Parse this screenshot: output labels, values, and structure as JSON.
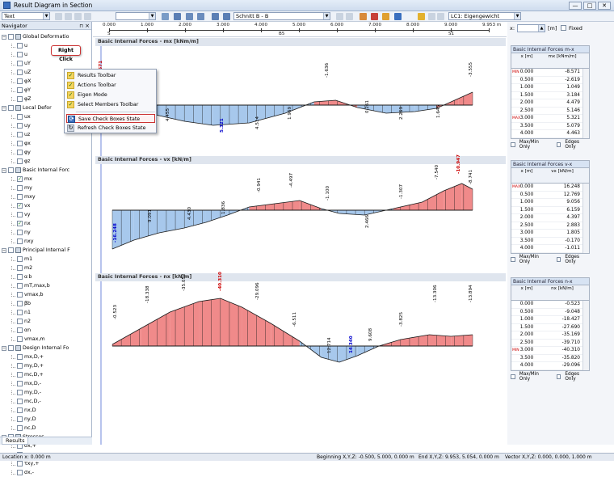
{
  "window": {
    "title": "Result Diagram in Section",
    "min": "—",
    "max": "□",
    "close": "✕"
  },
  "toolbar": {
    "text_combo": "Text",
    "section_combo": "Schnitt B - B",
    "lc_combo": "LC1: Eigengewicht"
  },
  "navigator": {
    "title": "Navigator",
    "tab": "Results",
    "groups": [
      {
        "label": "Global Deformatio",
        "items": [
          "u",
          "u",
          "uY",
          "uZ",
          "φX",
          "φY",
          "φZ"
        ]
      },
      {
        "label": "Local Defor",
        "items": [
          "ux",
          "uy",
          "uz",
          "φx",
          "φy",
          "φz"
        ]
      },
      {
        "label": "Basic Internal Forc",
        "items": [
          "mx",
          "my",
          "mxy",
          "vx",
          "vy",
          "nx",
          "ny",
          "nxy"
        ],
        "checked": [
          0,
          3,
          5
        ]
      },
      {
        "label": "Principal Internal F",
        "items": [
          "m1",
          "m2",
          "α b",
          "mT,max,b",
          "vmax,b",
          "βb",
          "n1",
          "n2",
          "αn",
          "vmax,m"
        ]
      },
      {
        "label": "Design Internal Fo",
        "items": [
          "mx,D,+",
          "my,D,+",
          "mc,D,+",
          "mx,D,-",
          "my,D,-",
          "mc,D,-",
          "nx,D",
          "ny,D",
          "nc,D"
        ]
      },
      {
        "label": "Stresses",
        "items": [
          "σx,+",
          "σy,+",
          "τxy,+",
          "σx,-"
        ]
      }
    ]
  },
  "callout": "Right Click",
  "context_menu": {
    "items": [
      {
        "label": "Results Toolbar",
        "checked": true
      },
      {
        "label": "Actions Toolbar",
        "checked": true
      },
      {
        "label": "Eigen Mode",
        "checked": true
      },
      {
        "label": "Select Members Toolbar",
        "checked": true
      }
    ],
    "save": "Save Check Boxes State",
    "refresh": "Refresh Check Boxes State"
  },
  "ruler": {
    "ticks": [
      "0.000",
      "1.000",
      "2.000",
      "3.000",
      "4.000",
      "5.000",
      "6.000",
      "7.000",
      "8.000",
      "9.000",
      "9.953 m"
    ],
    "labels": [
      "S",
      "B5",
      "S1"
    ],
    "scale_label": "0.1"
  },
  "right_controls": {
    "x_label": "x:",
    "unit": "[m]",
    "fixed": "Fixed"
  },
  "panels": [
    {
      "title": "Basic Internal Forces - mx [kNm/m]",
      "labels": [
        "-8.571",
        "4.455",
        "5.321",
        "4.514",
        "1.969",
        "-1.636",
        "0.261",
        "2.269",
        "1.645",
        "-3.555"
      ]
    },
    {
      "title": "Basic Internal Forces - vx [kN/m]",
      "labels": [
        "-16.248",
        "9.091",
        "4.430",
        "1.836",
        "-0.941",
        "-4.497",
        "-1.100",
        "2.466",
        "-1.307",
        "-7.540",
        "-10.947",
        "-8.741"
      ]
    },
    {
      "title": "Basic Internal Forces - nx [kN/m]",
      "labels": [
        "-0.523",
        "-18.338",
        "-35.052",
        "-40.310",
        "-29.096",
        "-6.511",
        "12.714",
        "14.340",
        "9.608",
        "-3.825",
        "-13.306",
        "-13.894"
      ]
    }
  ],
  "tables": [
    {
      "title": "Basic Internal Forces m-x",
      "col1": "x [m]",
      "col2": "mx [kNm/m]",
      "x": [
        "0.000",
        "0.500",
        "1.000",
        "1.500",
        "2.000",
        "2.500",
        "3.000",
        "3.500",
        "4.000"
      ],
      "v": [
        "-8.571",
        "-2.619",
        "1.049",
        "3.184",
        "4.479",
        "5.146",
        "5.321",
        "5.079",
        "4.463"
      ],
      "max_label": "MIN",
      "min_label": "MAX"
    },
    {
      "title": "Basic Internal Forces v-x",
      "col1": "x [m]",
      "col2": "vx [kN/m]",
      "x": [
        "0.000",
        "0.500",
        "1.000",
        "1.500",
        "2.000",
        "2.500",
        "3.000",
        "3.500",
        "4.000"
      ],
      "v": [
        "16.248",
        "12.769",
        "9.056",
        "6.159",
        "4.397",
        "2.883",
        "1.805",
        "-0.170",
        "-1.011"
      ],
      "max_label": "MAX",
      "min_label": ""
    },
    {
      "title": "Basic Internal Forces n-x",
      "col1": "x [m]",
      "col2": "nx [kN/m]",
      "x": [
        "0.000",
        "0.500",
        "1.000",
        "1.500",
        "2.000",
        "2.500",
        "3.000",
        "3.500",
        "4.000"
      ],
      "v": [
        "-0.523",
        "-9.048",
        "-18.427",
        "-27.690",
        "-35.169",
        "-39.710",
        "-40.310",
        "-35.820",
        "-29.096"
      ],
      "max_label": "",
      "min_label": "MIN"
    }
  ],
  "options": {
    "maxmin": "Max/Min Only",
    "edges": "Edges Only"
  },
  "status": {
    "location": "Location x: 0.000 m",
    "beginning": "Beginning X,Y,Z: -0.500, 5.000, 0.000 m",
    "end": "End X,Y,Z: 9.953, 5.054, 0.000 m",
    "vector": "Vector X,Y,Z: 0.000, 0.000, 1.000 m"
  }
}
